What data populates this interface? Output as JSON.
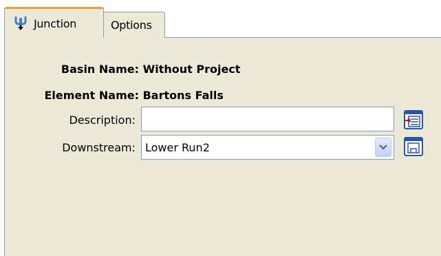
{
  "tabs": [
    {
      "label": "Junction",
      "icon": "junction-icon",
      "active": true
    },
    {
      "label": "Options",
      "active": false
    }
  ],
  "basin": {
    "label": "Basin Name:",
    "value": "Without Project"
  },
  "element": {
    "label": "Element Name:",
    "value": "Bartons Falls"
  },
  "description": {
    "label": "Description:",
    "value": "",
    "placeholder": "",
    "button_icon": "edit-description-icon"
  },
  "downstream": {
    "label": "Downstream:",
    "selected": "Lower Run2",
    "button_icon": "select-element-icon"
  },
  "colors": {
    "panel_background": "#ece9d8",
    "active_tab_accent": "#f0a030",
    "input_border": "#7f9db9"
  }
}
